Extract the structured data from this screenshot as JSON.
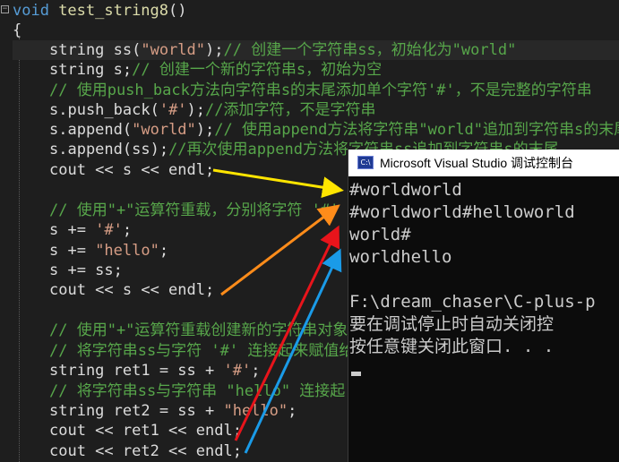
{
  "editor": {
    "fold_symbol": "−",
    "code": {
      "l1": {
        "kw": "void",
        "name": " test_string8",
        "rest": "()"
      },
      "l2": "{",
      "l3": {
        "t1": "string ss(",
        "s": "\"world\"",
        "t2": ");",
        "c": "// 创建一个字符串ss，初始化为\"world\""
      },
      "l4": {
        "t1": "string s;",
        "c": "// 创建一个新的字符串s，初始为空"
      },
      "l5": {
        "c": "// 使用push_back方法向字符串s的末尾添加单个字符'#'，不是完整的字符串"
      },
      "l6": {
        "t1": "s.push_back(",
        "s": "'#'",
        "t2": ");",
        "c": "//添加字符，不是字符串"
      },
      "l7": {
        "t1": "s.append(",
        "s": "\"world\"",
        "t2": ");",
        "c": "// 使用append方法将字符串\"world\"追加到字符串s的末尾"
      },
      "l8": {
        "t1": "s.append(ss);",
        "c": "//再次使用append方法将字符串ss追加到字符串s的末尾"
      },
      "l9": "cout << s << endl;",
      "l11": {
        "c": "// 使用\"+\"运算符重载，分别将字符 '#'"
      },
      "l12": {
        "t1": "s += ",
        "s": "'#'",
        "t2": ";"
      },
      "l13": {
        "t1": "s += ",
        "s": "\"hello\"",
        "t2": ";"
      },
      "l14": "s += ss;",
      "l15": "cout << s << endl;",
      "l17": {
        "c": "// 使用\"+\"运算符重载创建新的字符串对象"
      },
      "l18": {
        "c": "// 将字符串ss与字符 '#' 连接起来赋值给"
      },
      "l19": {
        "t1": "string ret1 = ss + ",
        "s": "'#'",
        "t2": ";"
      },
      "l20": {
        "c": "// 将字符串ss与字符串 \"hello\" 连接起"
      },
      "l21": {
        "t1": "string ret2 = ss + ",
        "s": "\"hello\"",
        "t2": ";"
      },
      "l22": "cout << ret1 << endl;",
      "l23": "cout << ret2 << endl;"
    }
  },
  "console": {
    "icon_text": "C:\\",
    "title": "Microsoft Visual Studio 调试控制台",
    "output": [
      "#worldworld",
      "#worldworld#helloworld",
      "world#",
      "worldhello",
      "",
      "F:\\dream_chaser\\C-plus-p",
      "要在调试停止时自动关闭控",
      "按任意键关闭此窗口. . ."
    ]
  },
  "annotation_colors": {
    "yellow": "#ffe500",
    "orange": "#ff8c1a",
    "red": "#e8141b",
    "blue": "#1a9be8"
  }
}
